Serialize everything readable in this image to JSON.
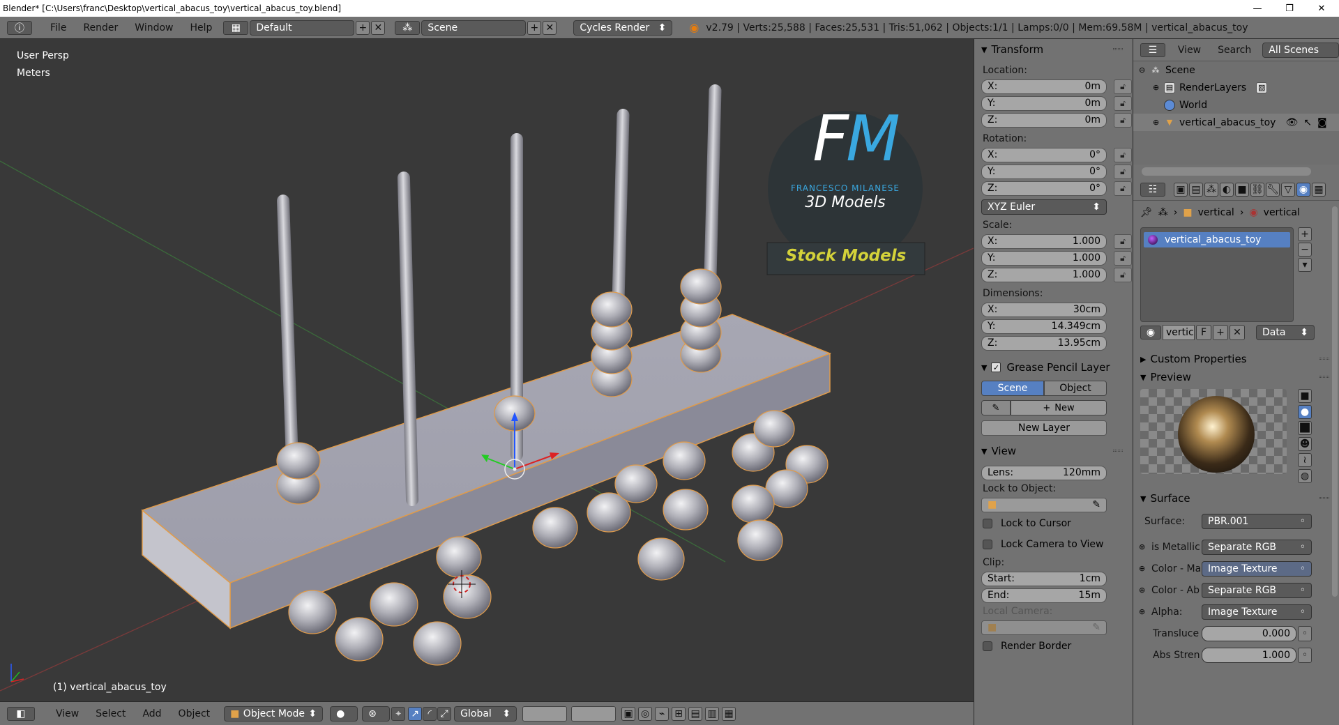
{
  "titlebar": {
    "title": "Blender* [C:\\Users\\franc\\Desktop\\vertical_abacus_toy\\vertical_abacus_toy.blend]",
    "minimize": "—",
    "maximize": "❐",
    "close": "✕"
  },
  "infobar": {
    "menus": [
      "File",
      "Render",
      "Window",
      "Help"
    ],
    "screen_layout": "Default",
    "scene": "Scene",
    "render_engine": "Cycles Render",
    "stats": "v2.79 | Verts:25,588 | Faces:25,531 | Tris:51,062 | Objects:1/1 | Lamps:0/0 | Mem:69.58M | vertical_abacus_toy"
  },
  "viewport": {
    "view_name": "User Persp",
    "units": "Meters",
    "object_label": "(1) vertical_abacus_toy",
    "logo": {
      "letters": "FM",
      "name": "FRANCESCO MILANESE",
      "tagline": "3D Models",
      "banner": "Stock Models"
    }
  },
  "vpheader": {
    "menus": [
      "View",
      "Select",
      "Add",
      "Object"
    ],
    "mode": "Object Mode",
    "orientation": "Global"
  },
  "npanel": {
    "transform": {
      "title": "Transform",
      "location_label": "Location:",
      "location": [
        {
          "axis": "X:",
          "value": "0m"
        },
        {
          "axis": "Y:",
          "value": "0m"
        },
        {
          "axis": "Z:",
          "value": "0m"
        }
      ],
      "rotation_label": "Rotation:",
      "rotation": [
        {
          "axis": "X:",
          "value": "0°"
        },
        {
          "axis": "Y:",
          "value": "0°"
        },
        {
          "axis": "Z:",
          "value": "0°"
        }
      ],
      "rotation_mode": "XYZ Euler",
      "scale_label": "Scale:",
      "scale": [
        {
          "axis": "X:",
          "value": "1.000"
        },
        {
          "axis": "Y:",
          "value": "1.000"
        },
        {
          "axis": "Z:",
          "value": "1.000"
        }
      ],
      "dimensions_label": "Dimensions:",
      "dimensions": [
        {
          "axis": "X:",
          "value": "30cm"
        },
        {
          "axis": "Y:",
          "value": "14.349cm"
        },
        {
          "axis": "Z:",
          "value": "13.95cm"
        }
      ]
    },
    "grease_pencil": {
      "title": "Grease Pencil Layer",
      "tab_scene": "Scene",
      "tab_object": "Object",
      "new": "New",
      "new_layer": "New Layer"
    },
    "view": {
      "title": "View",
      "lens_label": "Lens:",
      "lens_value": "120mm",
      "lock_to_object": "Lock to Object:",
      "lock_to_cursor": "Lock to Cursor",
      "lock_camera": "Lock Camera to View",
      "clip_label": "Clip:",
      "clip_start_label": "Start:",
      "clip_start": "1cm",
      "clip_end_label": "End:",
      "clip_end": "15m",
      "local_camera": "Local Camera:",
      "render_border": "Render Border"
    }
  },
  "outliner": {
    "view": "View",
    "search": "Search",
    "filter": "All Scenes",
    "items": [
      "Scene",
      "RenderLayers",
      "World",
      "vertical_abacus_toy"
    ]
  },
  "properties": {
    "breadcrumb": [
      "vertical",
      "vertical"
    ],
    "material_slot": "vertical_abacus_toy",
    "material_name": "vertic",
    "fake_user": "F",
    "link": "Data",
    "custom_properties": "Custom Properties",
    "preview": "Preview",
    "surface_title": "Surface",
    "surface_label": "Surface:",
    "surface_value": "PBR.001",
    "inputs": [
      {
        "label": "is Metallic",
        "value": "Separate RGB"
      },
      {
        "label": "Color - Ma",
        "value": "Image Texture"
      },
      {
        "label": "Color - Ab",
        "value": "Separate RGB"
      },
      {
        "label": "Alpha:",
        "value": "Image Texture"
      }
    ],
    "translucency_label": "Transluce",
    "translucency": "0.000",
    "abs_strength_label": "Abs Stren",
    "abs_strength": "1.000"
  }
}
